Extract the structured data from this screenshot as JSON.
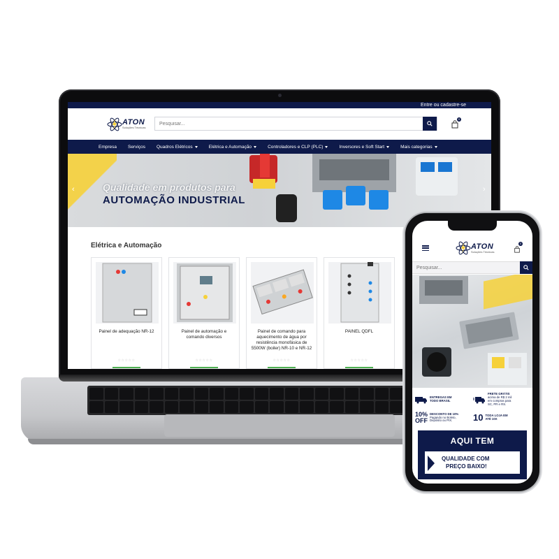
{
  "brand": {
    "name": "ATON",
    "tagline": "Soluções Técnicas",
    "navy": "#0e1a4a",
    "yellow": "#f6d13a"
  },
  "desktop": {
    "topbar_text": "Entre ou cadastre-se",
    "search_placeholder": "Pesquisar...",
    "cart_count": "0",
    "nav": [
      {
        "label": "Empresa",
        "dropdown": false
      },
      {
        "label": "Serviços",
        "dropdown": false
      },
      {
        "label": "Quadros Elétricos",
        "dropdown": true
      },
      {
        "label": "Elétrica e Automação",
        "dropdown": true
      },
      {
        "label": "Controladores e CLP (PLC)",
        "dropdown": true
      },
      {
        "label": "Inversores e Soft Start",
        "dropdown": true
      },
      {
        "label": "Mais categorias",
        "dropdown": true
      }
    ],
    "banner": {
      "line1": "Qualidade em produtos para",
      "line2": "AUTOMAÇÃO INDUSTRIAL",
      "prev_icon": "chevron-left-icon",
      "next_icon": "chevron-right-icon"
    },
    "section_title": "Elétrica e Automação",
    "products": [
      {
        "title": "Painel de adequação NR-12"
      },
      {
        "title": "Painel de automação e comando diversos"
      },
      {
        "title": "Painel de comando para aquecimento de água por resistência monofásica de 5500W (boiler) NR-10 e NR-12"
      },
      {
        "title": "PAINEL QDFL"
      }
    ],
    "stars": "☆☆☆☆☆"
  },
  "mobile": {
    "search_placeholder": "Pesquisar...",
    "cart_count": "0",
    "benefits": {
      "shipping": {
        "line1": "ENTREGAS EM",
        "line2": "TODO BRASIL"
      },
      "free": {
        "line1": "FRETE GRÁTIS",
        "line2": "acima de R$ 2 mil",
        "line3": "em compras para",
        "line4": "SC, PR e RS."
      },
      "discount": {
        "big": "10%",
        "big2": "OFF",
        "line1": "DESCONTO DE 10%",
        "line2": "Pagando no Boleto,",
        "line3": "Depósito ou PIX."
      },
      "installments": {
        "big": "10",
        "line1": "TODA LOJA EM",
        "line2": "ATÉ 10X"
      }
    },
    "promo": {
      "title": "AQUI TEM",
      "line1": "QUALIDADE COM",
      "line2": "PREÇO BAIXO!"
    }
  }
}
